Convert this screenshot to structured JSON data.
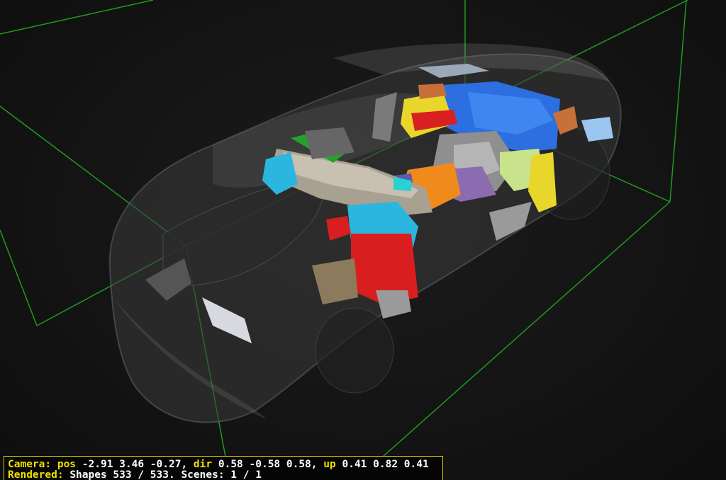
{
  "status_bar": {
    "camera_label": "Camera:",
    "pos_label": "pos",
    "pos_value": "-2.91 3.46 -0.27,",
    "dir_label": "dir",
    "dir_value": "0.58 -0.58 0.58,",
    "up_label": "up",
    "up_value": "0.41 0.82 0.41",
    "rendered_label": "Rendered:",
    "rendered_value": "Shapes 533 / 533. Scenes: 1 / 1"
  },
  "colors": {
    "bounding_box": "#1f9a1f",
    "status_border": "#d6c800",
    "label_yellow": "#f0e000",
    "value_white": "#ffffff"
  }
}
